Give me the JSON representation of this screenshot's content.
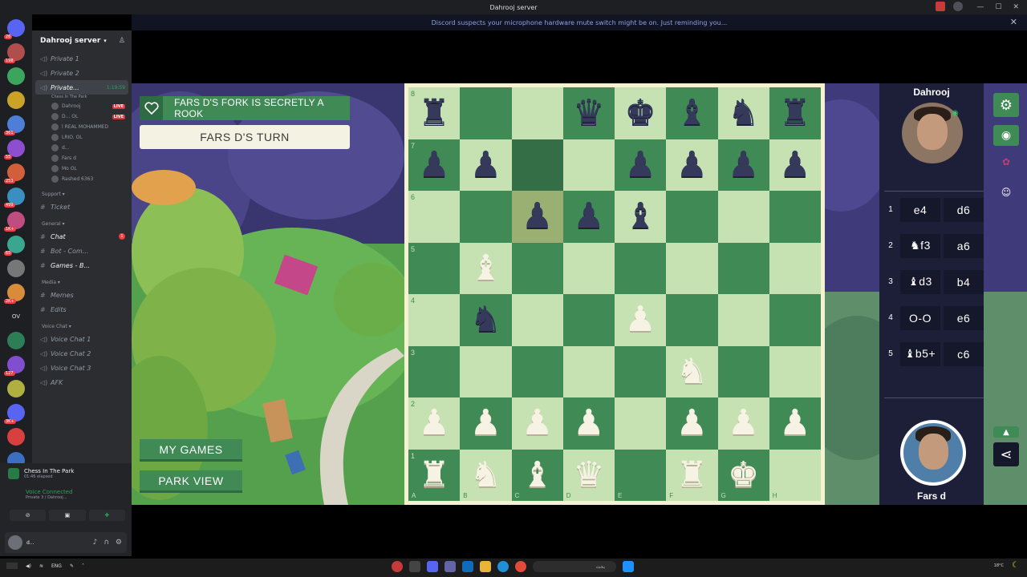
{
  "window": {
    "title": "Dahrooj server"
  },
  "notice": {
    "text": "Discord suspects your microphone hardware mute switch might be on. Just reminding you..."
  },
  "sidebar": {
    "server_name": "Dahrooj server",
    "channels": [
      {
        "name": "Private 1",
        "icon": "speaker-lock-icon"
      },
      {
        "name": "Private 2",
        "icon": "speaker-lock-icon"
      },
      {
        "name": "Private...",
        "icon": "speaker-lock-icon",
        "time": "1:19:59",
        "activity": "Chess In The Park",
        "selected": true
      }
    ],
    "voice_users": [
      {
        "name": "Dahrooj",
        "live": "LIVE"
      },
      {
        "name": "D...",
        "tag": "OL",
        "live": "LIVE"
      },
      {
        "name": "l REAL MOHAMMED"
      },
      {
        "name": "LRIO.",
        "tag": "OL"
      },
      {
        "name": "d..."
      },
      {
        "name": "Fars d"
      },
      {
        "name": "Mo",
        "tag": "OL"
      },
      {
        "name": "Rashed",
        "tag": "6363"
      }
    ],
    "categories": [
      {
        "name": "Support",
        "channels": [
          {
            "name": "Ticket",
            "icon": "hash-icon"
          }
        ]
      },
      {
        "name": "General",
        "channels": [
          {
            "name": "Chat",
            "icon": "hash-icon",
            "bright": true,
            "unread": "1"
          },
          {
            "name": "Bot - Com...",
            "icon": "hash-icon"
          },
          {
            "name": "Games - B...",
            "icon": "hash-icon",
            "bright": true
          }
        ]
      },
      {
        "name": "Media",
        "channels": [
          {
            "name": "Memes",
            "icon": "hash-icon"
          },
          {
            "name": "Edits",
            "icon": "hash-icon"
          }
        ]
      },
      {
        "name": "Voice Chat",
        "channels": [
          {
            "name": "Voice Chat 1",
            "icon": "speaker-icon"
          },
          {
            "name": "Voice Chat 2",
            "icon": "speaker-icon"
          },
          {
            "name": "Voice Chat 3",
            "icon": "speaker-icon"
          },
          {
            "name": "AFK",
            "icon": "speaker-icon"
          }
        ]
      }
    ]
  },
  "voice_panel": {
    "activity_name": "Chess In The Park",
    "activity_elapsed": "01:46 elapsed",
    "status": "Voice Connected",
    "location": "Private 3 / Dahrooj...",
    "user_name": "d..."
  },
  "server_rail": {
    "badges": [
      "26",
      "198",
      "",
      "",
      "361",
      "55",
      "253",
      "499",
      "1K+",
      "65",
      "",
      "2K+",
      "OV",
      "",
      "127",
      "",
      "3K+",
      "",
      "195",
      ""
    ]
  },
  "game": {
    "banner": "FARS D'S FORK IS SECRETLY A ROOK",
    "turn": "FARS D'S TURN",
    "buttons": {
      "my_games": "MY GAMES",
      "park_view": "PARK VIEW"
    },
    "opponent": {
      "name": "Dahrooj"
    },
    "player": {
      "name": "Fars d"
    },
    "moves": [
      {
        "n": "1",
        "white": "e4",
        "black": "d6"
      },
      {
        "n": "2",
        "white": "♞f3",
        "black": "a6"
      },
      {
        "n": "3",
        "white": "♝d3",
        "black": "b4"
      },
      {
        "n": "4",
        "white": "O-O",
        "black": "e6"
      },
      {
        "n": "5",
        "white": "♝b5+",
        "black": "c6"
      }
    ],
    "board": [
      [
        "br",
        "",
        "",
        "bq",
        "bk",
        "bb",
        "bn",
        "br"
      ],
      [
        "bp",
        "bp",
        "",
        "",
        "bp",
        "bp",
        "bp",
        "bp"
      ],
      [
        "",
        "",
        "bp",
        "bp",
        "bb",
        "",
        "",
        ""
      ],
      [
        "",
        "wb",
        "",
        "",
        "",
        "",
        "",
        ""
      ],
      [
        "",
        "bn",
        "",
        "",
        "wp",
        "",
        "",
        ""
      ],
      [
        "",
        "",
        "",
        "",
        "",
        "wn",
        "",
        ""
      ],
      [
        "wp",
        "wp",
        "wp",
        "wp",
        "",
        "wp",
        "wp",
        "wp"
      ],
      [
        "wr",
        "wn",
        "wb",
        "wq",
        "",
        "wr",
        "wk",
        ""
      ]
    ],
    "highlights": [
      "c7",
      "c6"
    ],
    "files": [
      "A",
      "B",
      "C",
      "D",
      "E",
      "F",
      "G",
      "H"
    ],
    "ranks": [
      "8",
      "7",
      "6",
      "5",
      "4",
      "3",
      "2",
      "1"
    ]
  },
  "taskbar": {
    "language": "ENG",
    "search_placeholder": "بحث",
    "weather": "18°C"
  }
}
